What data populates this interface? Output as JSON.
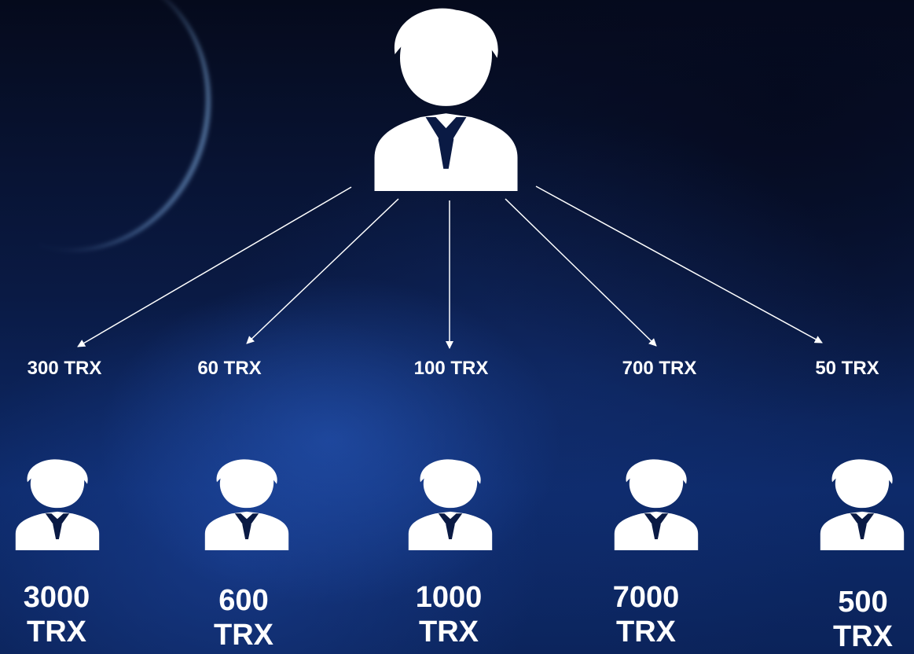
{
  "top_node": {
    "icon": "person-icon"
  },
  "edges": [
    {
      "label": "300 TRX"
    },
    {
      "label": "60 TRX"
    },
    {
      "label": "100 TRX"
    },
    {
      "label": "700 TRX"
    },
    {
      "label": "50 TRX"
    }
  ],
  "children": [
    {
      "icon": "person-icon",
      "amount_line1": "3000",
      "amount_line2": "TRX"
    },
    {
      "icon": "person-icon",
      "amount_line1": "600",
      "amount_line2": "TRX"
    },
    {
      "icon": "person-icon",
      "amount_line1": "1000",
      "amount_line2": "TRX"
    },
    {
      "icon": "person-icon",
      "amount_line1": "7000",
      "amount_line2": "TRX"
    },
    {
      "icon": "person-icon",
      "amount_line1": "500",
      "amount_line2": "TRX"
    }
  ],
  "colors": {
    "text": "#ffffff",
    "arrow": "#ffffff"
  }
}
